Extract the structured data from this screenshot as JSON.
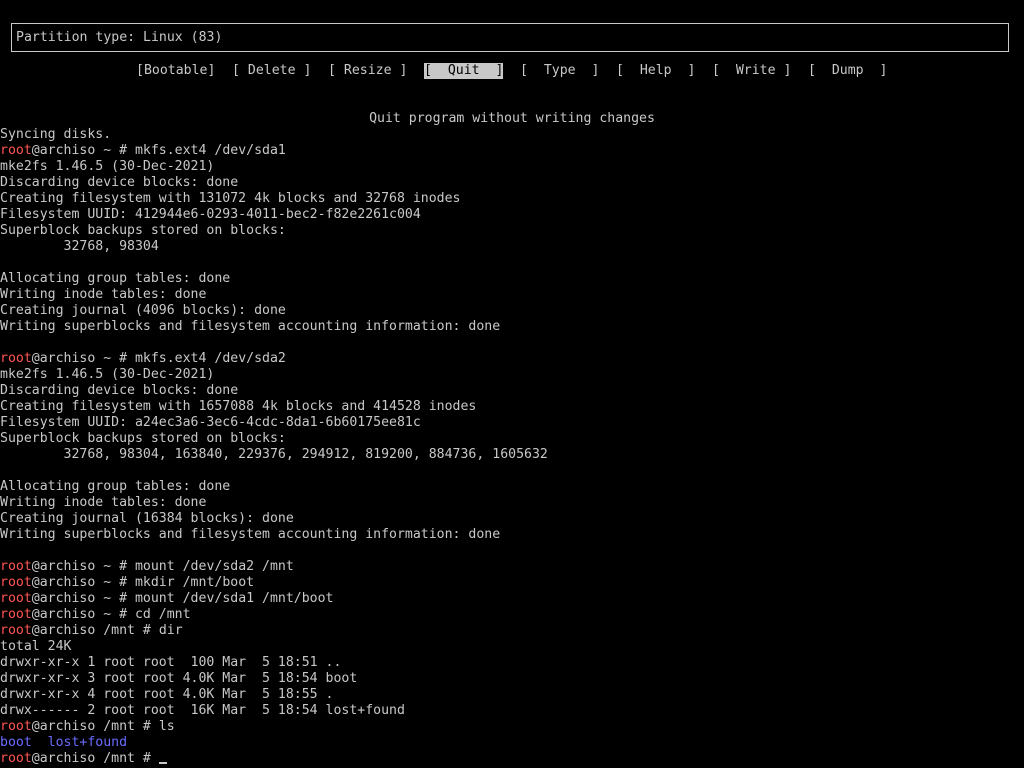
{
  "partition": {
    "text": "Partition type: Linux (83)"
  },
  "menu": {
    "items": [
      {
        "label": "[Bootable]",
        "selected": false
      },
      {
        "label": "[ Delete ]",
        "selected": false
      },
      {
        "label": "[ Resize ]",
        "selected": false
      },
      {
        "label": "[  Quit  ]",
        "selected": true
      },
      {
        "label": "[  Type  ]",
        "selected": false
      },
      {
        "label": "[  Help  ]",
        "selected": false
      },
      {
        "label": "[  Write ]",
        "selected": false
      },
      {
        "label": "[  Dump  ]",
        "selected": false
      }
    ]
  },
  "hint": "Quit program without writing changes",
  "terminal": {
    "user_host": "root@archiso",
    "lines": [
      {
        "text": "Syncing disks."
      },
      {
        "prompt": true,
        "path": "~",
        "cmd": "mkfs.ext4 /dev/sda1"
      },
      {
        "text": "mke2fs 1.46.5 (30-Dec-2021)"
      },
      {
        "text": "Discarding device blocks: done"
      },
      {
        "text": "Creating filesystem with 131072 4k blocks and 32768 inodes"
      },
      {
        "text": "Filesystem UUID: 412944e6-0293-4011-bec2-f82e2261c004"
      },
      {
        "text": "Superblock backups stored on blocks:"
      },
      {
        "text": "        32768, 98304"
      },
      {
        "text": ""
      },
      {
        "text": "Allocating group tables: done"
      },
      {
        "text": "Writing inode tables: done"
      },
      {
        "text": "Creating journal (4096 blocks): done"
      },
      {
        "text": "Writing superblocks and filesystem accounting information: done"
      },
      {
        "text": ""
      },
      {
        "prompt": true,
        "path": "~",
        "cmd": "mkfs.ext4 /dev/sda2"
      },
      {
        "text": "mke2fs 1.46.5 (30-Dec-2021)"
      },
      {
        "text": "Discarding device blocks: done"
      },
      {
        "text": "Creating filesystem with 1657088 4k blocks and 414528 inodes"
      },
      {
        "text": "Filesystem UUID: a24ec3a6-3ec6-4cdc-8da1-6b60175ee81c"
      },
      {
        "text": "Superblock backups stored on blocks:"
      },
      {
        "text": "        32768, 98304, 163840, 229376, 294912, 819200, 884736, 1605632"
      },
      {
        "text": ""
      },
      {
        "text": "Allocating group tables: done"
      },
      {
        "text": "Writing inode tables: done"
      },
      {
        "text": "Creating journal (16384 blocks): done"
      },
      {
        "text": "Writing superblocks and filesystem accounting information: done"
      },
      {
        "text": ""
      },
      {
        "prompt": true,
        "path": "~",
        "cmd": "mount /dev/sda2 /mnt"
      },
      {
        "prompt": true,
        "path": "~",
        "cmd": "mkdir /mnt/boot"
      },
      {
        "prompt": true,
        "path": "~",
        "cmd": "mount /dev/sda1 /mnt/boot"
      },
      {
        "prompt": true,
        "path": "~",
        "cmd": "cd /mnt"
      },
      {
        "prompt": true,
        "path": "/mnt",
        "cmd": "dir"
      },
      {
        "text": "total 24K"
      },
      {
        "text": "drwxr-xr-x 1 root root  100 Mar  5 18:51 .."
      },
      {
        "text": "drwxr-xr-x 3 root root 4.0K Mar  5 18:54 boot"
      },
      {
        "text": "drwxr-xr-x 4 root root 4.0K Mar  5 18:55 ."
      },
      {
        "text": "drwx------ 2 root root  16K Mar  5 18:54 lost+found"
      },
      {
        "prompt": true,
        "path": "/mnt",
        "cmd": "ls"
      },
      {
        "ls": [
          "boot",
          "lost+found"
        ]
      },
      {
        "prompt": true,
        "path": "/mnt",
        "cmd": "",
        "cursor": true
      }
    ]
  },
  "colors": {
    "background": "#000000",
    "foreground": "#c8c8c8",
    "prompt_user": "#ff5555",
    "directory": "#6b6bff",
    "selected_bg": "#c8c8c8"
  }
}
